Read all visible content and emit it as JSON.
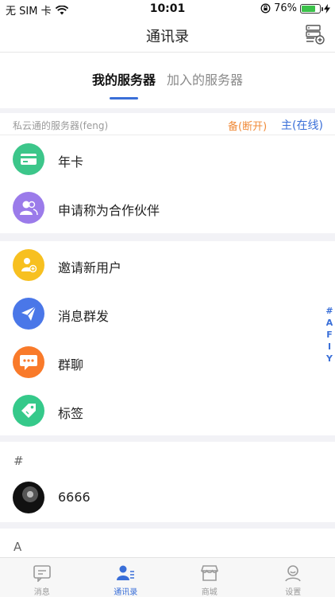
{
  "status_bar": {
    "carrier": "无 SIM 卡",
    "time": "10:01",
    "battery": "76%",
    "battery_level": 0.76,
    "wifi_icon": "wifi-icon",
    "lock_icon": "rotation-lock-icon",
    "charge_icon": "charging-bolt-icon"
  },
  "navbar": {
    "title": "通讯录",
    "right_icon": "server-add-icon"
  },
  "tabs": [
    {
      "label": "我的服务器",
      "active": true
    },
    {
      "label": "加入的服务器",
      "active": false
    }
  ],
  "server": {
    "name": "私云通的服务器(feng)",
    "backup_status": "备(断开)",
    "main_status": "主(在线)"
  },
  "menu_group1": [
    {
      "label": "年卡",
      "icon": "card-icon",
      "color": "#3cc68a"
    },
    {
      "label": "申请称为合作伙伴",
      "icon": "partner-icon",
      "color": "#9b7bea"
    }
  ],
  "menu_group2": [
    {
      "label": "邀请新用户",
      "icon": "invite-user-icon",
      "color": "#f7c020"
    },
    {
      "label": "消息群发",
      "icon": "send-icon",
      "color": "#4a77e8"
    },
    {
      "label": "群聊",
      "icon": "group-chat-icon",
      "color": "#f97a2a"
    },
    {
      "label": "标签",
      "icon": "tag-icon",
      "color": "#35c98a"
    }
  ],
  "index_letters": [
    "#",
    "A",
    "F",
    "I",
    "Y"
  ],
  "groups": [
    {
      "header": "#",
      "contacts": [
        {
          "name": "6666"
        }
      ]
    },
    {
      "header": "A",
      "contacts": []
    }
  ],
  "tabbar": [
    {
      "label": "消息",
      "icon": "message-icon",
      "active": false
    },
    {
      "label": "通讯录",
      "icon": "contacts-icon",
      "active": true
    },
    {
      "label": "商城",
      "icon": "store-icon",
      "active": false
    },
    {
      "label": "设置",
      "icon": "settings-user-icon",
      "active": false
    }
  ],
  "colors": {
    "accent": "#3a6fd8",
    "warning": "#f08b3a"
  }
}
